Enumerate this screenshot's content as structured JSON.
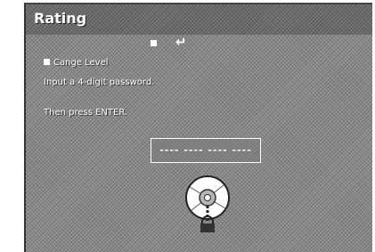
{
  "window": {
    "title": "Rating"
  },
  "nav": {
    "enter_symbol": "↵"
  },
  "menu": {
    "item_label": "Cange Level"
  },
  "prompt": {
    "line1": "Input a 4-digit password.",
    "line2": "Then press ENTER."
  },
  "password": {
    "value": "---- ---- ---- ----"
  },
  "icons": {
    "disc": "disc-icon",
    "lock": "lock-icon",
    "enter": "enter-icon",
    "square": "square-icon"
  },
  "colors": {
    "background": "#8a8a8a",
    "title_bar": "#6e6e6e",
    "text": "#ffffff"
  }
}
